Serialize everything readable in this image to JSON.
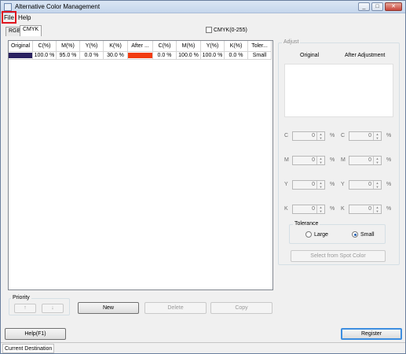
{
  "window": {
    "title": "Alternative Color Management",
    "min": "_",
    "max": "□",
    "close": "✕"
  },
  "menu": {
    "file": "File",
    "help": "Help"
  },
  "tabs": {
    "rgb": "RGB",
    "cmyk": "CMYK"
  },
  "cmyk_range_label": "CMYK(0-255)",
  "table": {
    "headers": [
      "Original",
      "C(%)",
      "M(%)",
      "Y(%)",
      "K(%)",
      "After ...",
      "C(%)",
      "M(%)",
      "Y(%)",
      "K(%)",
      "Toler..."
    ],
    "rows": [
      {
        "original_color": "#2a2160",
        "orig_c": "100.0 %",
        "orig_m": "95.0 %",
        "orig_y": "0.0 %",
        "orig_k": "30.0 %",
        "after_color": "#f23c10",
        "after_c": "0.0 %",
        "after_m": "100.0 %",
        "after_y": "100.0 %",
        "after_k": "0.0 %",
        "tolerance": "Small"
      }
    ]
  },
  "adjust": {
    "legend": "Adjust",
    "original_header": "Original",
    "after_header": "After Adjustment",
    "labels": {
      "c": "C",
      "m": "M",
      "y": "Y",
      "k": "K"
    },
    "percent": "%",
    "values": {
      "orig_c": "0",
      "orig_m": "0",
      "orig_y": "0",
      "orig_k": "0",
      "after_c": "0",
      "after_m": "0",
      "after_y": "0",
      "after_k": "0"
    },
    "tolerance": {
      "legend": "Tolerance",
      "large": "Large",
      "small": "Small",
      "selected": "Small"
    },
    "spot_button": "Select from Spot Color"
  },
  "priority": {
    "legend": "Priority",
    "up": "↑",
    "down": "↓"
  },
  "buttons": {
    "new": "New",
    "delete": "Delete",
    "copy": "Copy",
    "help": "Help(F1)",
    "register": "Register"
  },
  "status": {
    "destination": "Current Destination"
  }
}
